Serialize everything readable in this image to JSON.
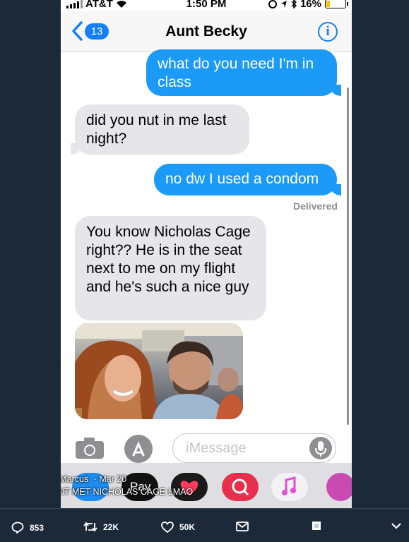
{
  "status_bar": {
    "carrier": "AT&T",
    "time": "1:50 PM",
    "battery": "16%",
    "battery_fraction": 0.16
  },
  "nav": {
    "back_count": "13",
    "title": "Aunt Becky",
    "info_glyph": "i"
  },
  "messages": [
    {
      "direction": "outgoing",
      "text": "what do you need I'm in class"
    },
    {
      "direction": "incoming",
      "text": "did you nut in me last night?"
    },
    {
      "direction": "outgoing",
      "text": "no dw I used a condom"
    },
    {
      "direction": "incoming",
      "text": "You know Nicholas Cage right?? He is in the seat next to me on my flight and he's such a nice guy"
    },
    {
      "direction": "incoming",
      "type": "photo"
    }
  ],
  "delivered_label": "Delivered",
  "input": {
    "placeholder": "iMessage"
  },
  "app_drawer": {
    "apple_pay_label": "Pay",
    "icons": [
      "app-store-icon",
      "apple-pay-icon",
      "digital-touch-icon",
      "image-search-icon",
      "music-icon",
      "photos-app-icon"
    ]
  },
  "tweet": {
    "handle": "@SmallDickMarcus",
    "date": "· Mar 20",
    "text": "YOO MY AUNT MET NICHOLAS CAGE LMAO"
  },
  "actions": {
    "replies": "853",
    "retweets": "22K",
    "likes": "50K"
  },
  "colors": {
    "background": "#1c2938",
    "imessage_blue": "#1b9af7",
    "incoming_gray": "#e5e5ea",
    "ios_blue": "#147efb"
  }
}
